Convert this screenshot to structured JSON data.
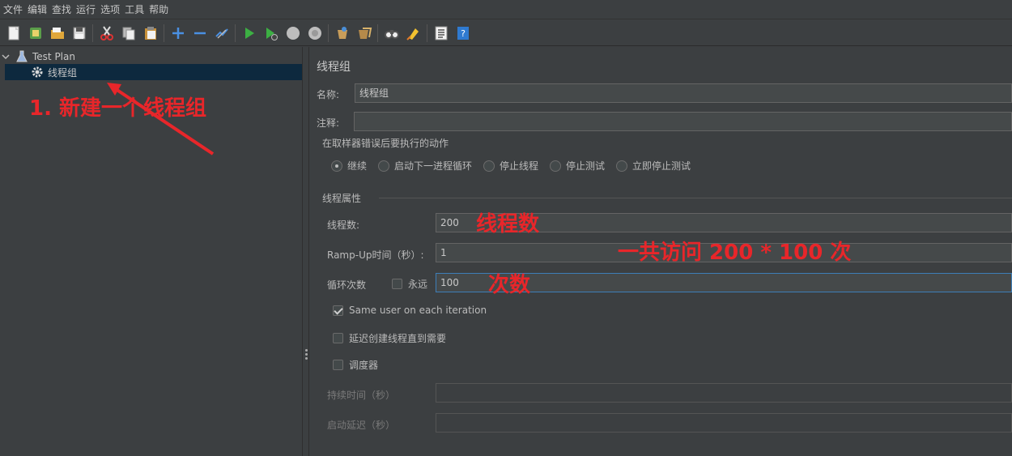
{
  "menu": [
    "文件",
    "编辑",
    "查找",
    "运行",
    "选项",
    "工具",
    "帮助"
  ],
  "toolbar_icons": [
    "new-icon",
    "templates-icon",
    "open-icon",
    "save-icon",
    "cut-icon",
    "copy-icon",
    "paste-icon",
    "expand-icon",
    "collapse-icon",
    "toggle-icon",
    "start-icon",
    "start-no-pause-icon",
    "stop-icon",
    "shutdown-icon",
    "clear-icon",
    "clear-all-icon",
    "search-icon",
    "reset-search-icon",
    "function-helper-icon",
    "help-icon"
  ],
  "tree": {
    "root_label": "Test Plan",
    "child_label": "线程组"
  },
  "panel": {
    "title": "线程组",
    "name_label": "名称:",
    "name_value": "线程组",
    "comment_label": "注释:",
    "comment_value": "",
    "error_group_title": "在取样器错误后要执行的动作",
    "error_actions": [
      {
        "label": "继续",
        "selected": true
      },
      {
        "label": "启动下一进程循环",
        "selected": false
      },
      {
        "label": "停止线程",
        "selected": false
      },
      {
        "label": "停止测试",
        "selected": false
      },
      {
        "label": "立即停止测试",
        "selected": false
      }
    ],
    "props_group_title": "线程属性",
    "threads_label": "线程数:",
    "threads_value": "200",
    "rampup_label": "Ramp-Up时间（秒）:",
    "rampup_value": "1",
    "loop_label": "循环次数",
    "forever_label": "永远",
    "loop_value": "100",
    "same_user_label": "Same user on each iteration",
    "delay_create_label": "延迟创建线程直到需要",
    "scheduler_label": "调度器",
    "duration_label": "持续时间（秒）",
    "startup_delay_label": "启动延迟（秒）"
  },
  "annotations": {
    "new_group": "1. 新建一个线程组",
    "threads_note": "线程数",
    "total_note": "一共访问 200 * 100 次",
    "loops_note": "次数"
  },
  "colors": {
    "background": "#3c3f41",
    "annotation": "#e8262a",
    "selection": "#0d293e"
  }
}
